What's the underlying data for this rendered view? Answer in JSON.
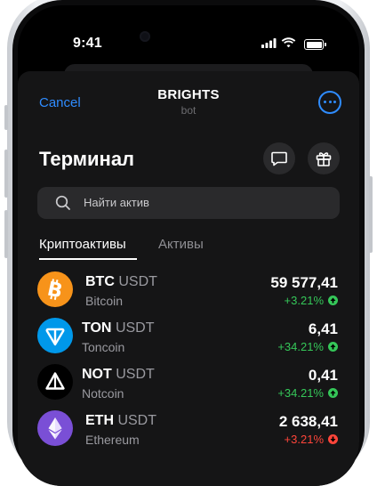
{
  "status_bar": {
    "time": "9:41"
  },
  "nav": {
    "cancel_label": "Cancel",
    "title": "BRIGHTS",
    "subtitle": "bot"
  },
  "page": {
    "heading": "Терминал"
  },
  "search": {
    "placeholder": "Найти актив"
  },
  "tabs": [
    {
      "label": "Криптоактивы",
      "active": true
    },
    {
      "label": "Активы",
      "active": false
    }
  ],
  "colors": {
    "accent": "#2f8cff",
    "up": "#35c759",
    "down": "#ff453a"
  },
  "assets": [
    {
      "base": "BTC",
      "quote": "USDT",
      "name": "Bitcoin",
      "price": "59 577,41",
      "change": "+3.21%",
      "direction": "up",
      "icon": "bitcoin-icon",
      "color": "#f7931a"
    },
    {
      "base": "TON",
      "quote": "USDT",
      "name": "Toncoin",
      "price": "6,41",
      "change": "+34.21%",
      "direction": "up",
      "icon": "toncoin-icon",
      "color": "#0098ea"
    },
    {
      "base": "NOT",
      "quote": "USDT",
      "name": "Notcoin",
      "price": "0,41",
      "change": "+34.21%",
      "direction": "up",
      "icon": "notcoin-icon",
      "color": "#000000"
    },
    {
      "base": "ETH",
      "quote": "USDT",
      "name": "Ethereum",
      "price": "2 638,41",
      "change": "+3.21%",
      "direction": "down",
      "icon": "ethereum-icon",
      "color": "#7a4fd6"
    }
  ]
}
